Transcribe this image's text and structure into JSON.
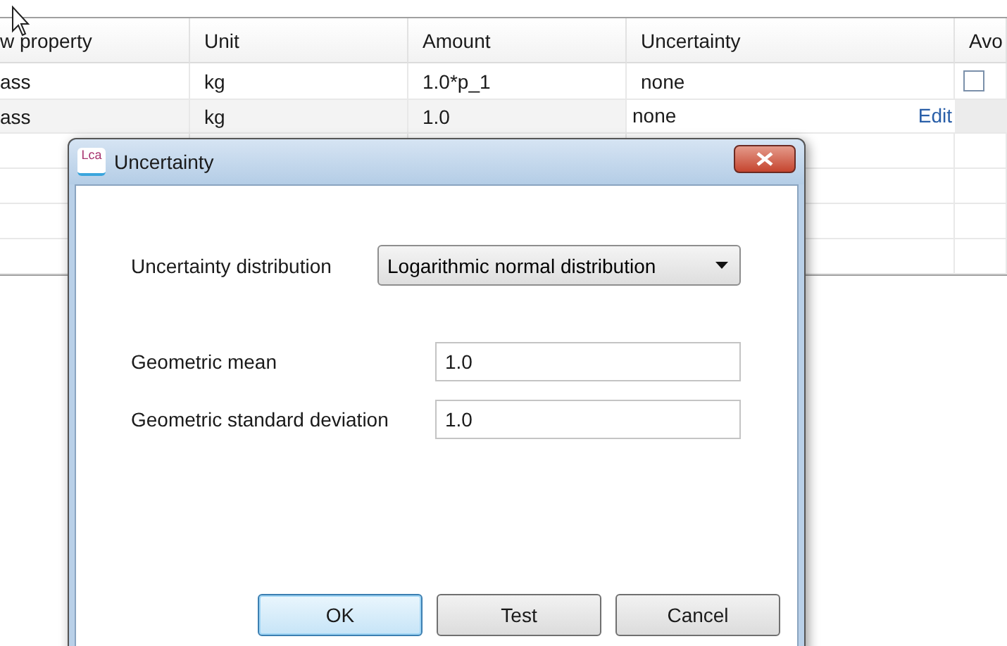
{
  "table": {
    "columns": [
      "w property",
      "Unit",
      "Amount",
      "Uncertainty",
      "Avo"
    ],
    "rows": [
      {
        "kind": "plain",
        "cells": [
          "ass",
          "kg",
          "1.0*p_1",
          "none"
        ],
        "avoided": false
      },
      {
        "kind": "editing",
        "cells": [
          "ass",
          "kg",
          "1.0",
          "none"
        ],
        "edit_link": "Edit"
      }
    ]
  },
  "dialog": {
    "logo": "Lca",
    "title": "Uncertainty",
    "distribution": {
      "label": "Uncertainty distribution",
      "value": "Logarithmic normal distribution"
    },
    "fields": [
      {
        "label": "Geometric mean",
        "value": "1.0"
      },
      {
        "label": "Geometric standard deviation",
        "value": "1.0"
      }
    ],
    "buttons": [
      {
        "label": "OK",
        "default": true
      },
      {
        "label": "Test",
        "default": false
      },
      {
        "label": "Cancel",
        "default": false
      }
    ]
  }
}
